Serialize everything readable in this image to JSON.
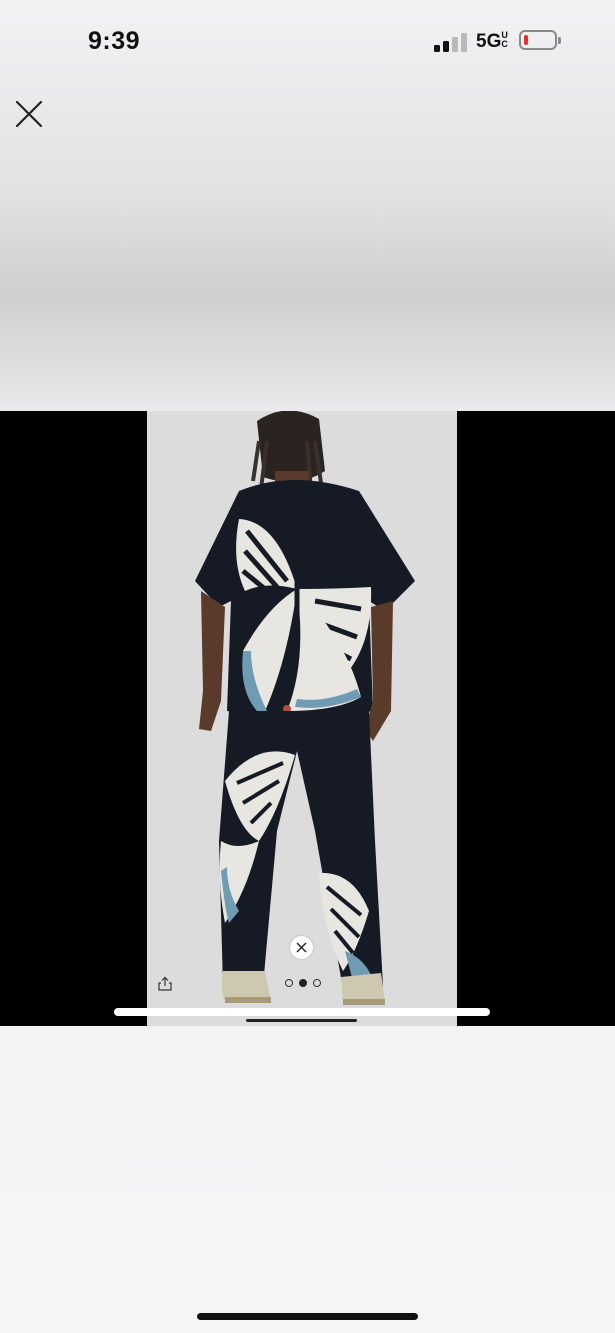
{
  "status_bar": {
    "time": "9:39",
    "network": "5G",
    "network_superscript": "UC",
    "signal_bars_active": 2,
    "signal_bars_total": 4,
    "battery_level": 0.1,
    "battery_color": "#e0342b"
  },
  "viewer": {
    "close_icon": "close-icon",
    "image_subject": "product-photo",
    "dismiss_icon": "close-circle-icon",
    "share_icon": "share-icon",
    "page_count": 3,
    "current_page": 2
  },
  "colors": {
    "background_black": "#000000",
    "photo_bg": "#dcdcdc",
    "garment": "#151a24",
    "butterfly_light": "#e8e6e1",
    "butterfly_blue": "#6f9bb3"
  }
}
